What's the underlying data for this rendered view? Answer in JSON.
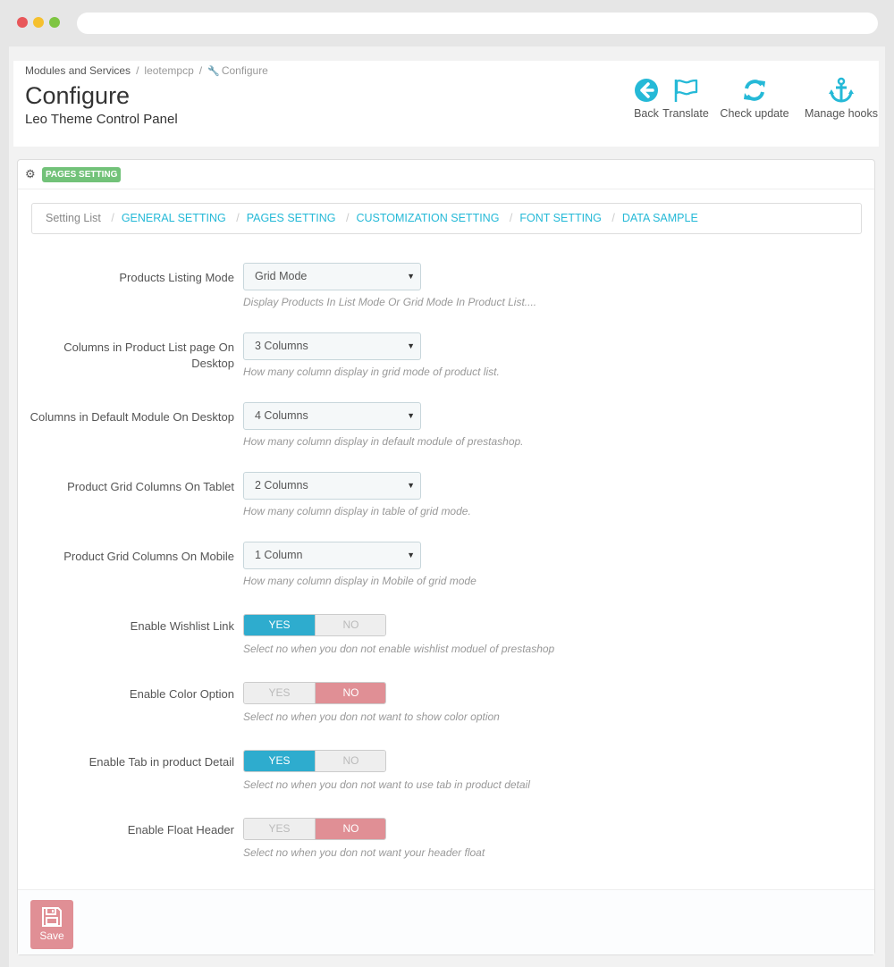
{
  "header": {
    "breadcrumb": [
      "Modules and Services",
      "leotempcp",
      "Configure"
    ],
    "title": "Configure",
    "subtitle": "Leo Theme Control Panel",
    "toolbar": [
      {
        "label": "Back",
        "icon": "back-arrow-icon"
      },
      {
        "label": "Translate",
        "icon": "flag-icon"
      },
      {
        "label": "Check update",
        "icon": "refresh-icon"
      },
      {
        "label": "Manage hooks",
        "icon": "anchor-icon"
      }
    ]
  },
  "panel": {
    "heading": "PAGES SETTING",
    "nav": {
      "first": "Setting List",
      "links": [
        "GENERAL SETTING",
        "PAGES SETTING",
        "CUSTOMIZATION SETTING",
        "FONT SETTING",
        "DATA SAMPLE"
      ]
    },
    "selects": [
      {
        "label": "Products Listing Mode",
        "value": "Grid Mode",
        "help": "Display Products In List Mode Or Grid Mode In Product List...."
      },
      {
        "label": "Columns in Product List page On Desktop",
        "value": "3 Columns",
        "help": "How many column display in grid mode of product list."
      },
      {
        "label": "Columns in Default Module On Desktop",
        "value": "4 Columns",
        "help": "How many column display in default module of prestashop."
      },
      {
        "label": "Product Grid Columns On Tablet",
        "value": "2 Columns",
        "help": "How many column display in table of grid mode."
      },
      {
        "label": "Product Grid Columns On Mobile",
        "value": "1 Column",
        "help": "How many column display in Mobile of grid mode"
      }
    ],
    "switches": [
      {
        "label": "Enable Wishlist Link",
        "value": "YES",
        "help": "Select no when you don not enable wishlist moduel of prestashop"
      },
      {
        "label": "Enable Color Option",
        "value": "NO",
        "help": "Select no when you don not want to show color option"
      },
      {
        "label": "Enable Tab in product Detail",
        "value": "YES",
        "help": "Select no when you don not want to use tab in product detail"
      },
      {
        "label": "Enable Float Header",
        "value": "NO",
        "help": "Select no when you don not want your header float"
      }
    ],
    "switch_yes": "YES",
    "switch_no": "NO",
    "save_label": "Save"
  },
  "colors": {
    "accent": "#25b9d7",
    "yes_on": "#2eacce",
    "no_on": "#e08f95",
    "badge": "#72c279"
  }
}
